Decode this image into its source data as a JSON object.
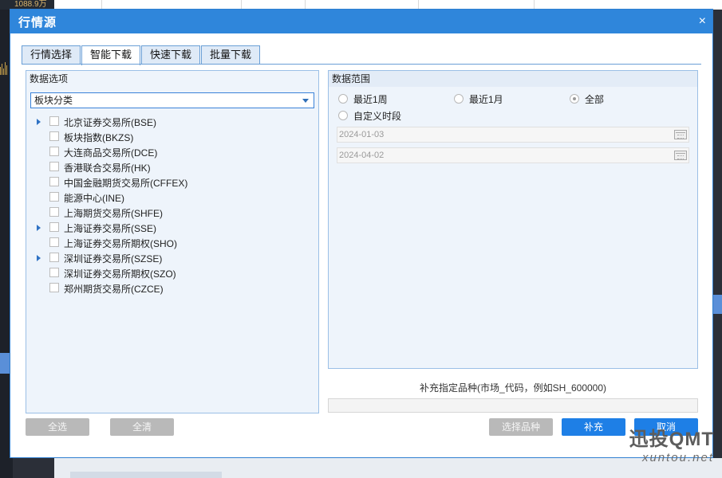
{
  "background": {
    "left_value": "1088.9万"
  },
  "dialog": {
    "title": "行情源",
    "close_symbol": "×"
  },
  "tabs": [
    {
      "label": "行情选择"
    },
    {
      "label": "智能下载"
    },
    {
      "label": "快速下载"
    },
    {
      "label": "批量下载"
    }
  ],
  "data_options": {
    "title": "数据选项",
    "category_select": "板块分类",
    "markets": [
      {
        "label": "北京证券交易所(BSE)",
        "expandable": true
      },
      {
        "label": "板块指数(BKZS)",
        "expandable": false
      },
      {
        "label": "大连商品交易所(DCE)",
        "expandable": false
      },
      {
        "label": "香港联合交易所(HK)",
        "expandable": false
      },
      {
        "label": "中国金融期货交易所(CFFEX)",
        "expandable": false
      },
      {
        "label": "能源中心(INE)",
        "expandable": false
      },
      {
        "label": "上海期货交易所(SHFE)",
        "expandable": false
      },
      {
        "label": "上海证券交易所(SSE)",
        "expandable": true
      },
      {
        "label": "上海证券交易所期权(SHO)",
        "expandable": false
      },
      {
        "label": "深圳证券交易所(SZSE)",
        "expandable": true
      },
      {
        "label": "深圳证券交易所期权(SZO)",
        "expandable": false
      },
      {
        "label": "郑州期货交易所(CZCE)",
        "expandable": false
      }
    ],
    "select_all_label": "全选",
    "clear_label": "全清"
  },
  "data_range": {
    "title": "数据范围",
    "options": [
      {
        "label": "最近1周",
        "selected": false
      },
      {
        "label": "最近1月",
        "selected": false
      },
      {
        "label": "全部",
        "selected": true
      },
      {
        "label": "自定义时段",
        "selected": false
      }
    ],
    "start_date": "2024-01-03",
    "end_date": "2024-04-02"
  },
  "supplement": {
    "label": "补充指定品种(市场_代码，例如SH_600000)",
    "value": ""
  },
  "actions": {
    "select_variety_label": "选择品种",
    "supplement_label": "补充",
    "cancel_label": "取消"
  },
  "watermark": {
    "main": "迅投QMT",
    "sub": "xuntou.net"
  }
}
